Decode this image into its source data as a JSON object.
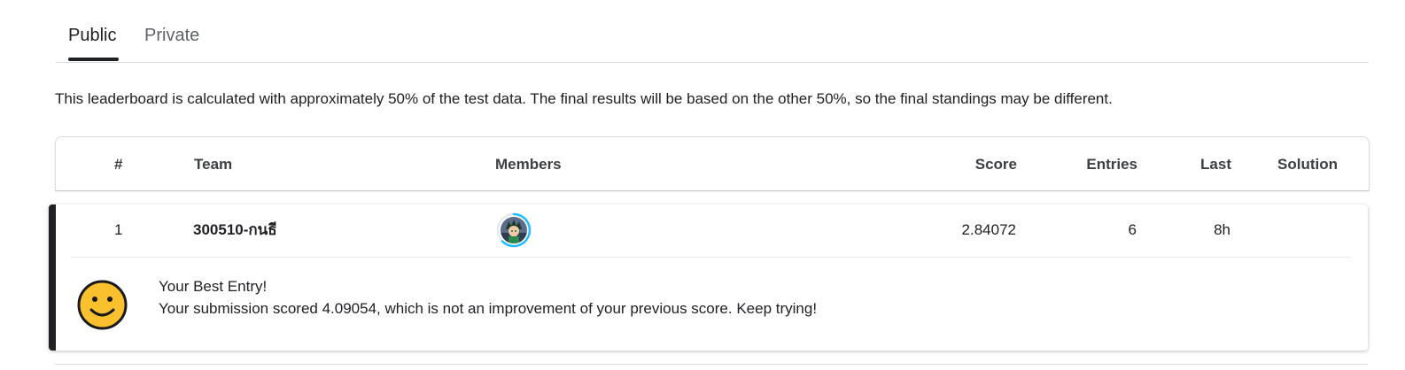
{
  "tabs": [
    {
      "label": "Public",
      "active": true
    },
    {
      "label": "Private",
      "active": false
    }
  ],
  "notice": "This leaderboard is calculated with approximately 50% of the test data. The final results will be based on the other 50%, so the final standings may be different.",
  "table": {
    "columns": [
      "#",
      "Team",
      "Members",
      "Score",
      "Entries",
      "Last",
      "Solution"
    ],
    "rows": [
      {
        "rank": "1",
        "team": "300510-กนธี",
        "members_icon": "user-avatar",
        "score": "2.84072",
        "entries": "6",
        "last": "8h",
        "solution": ""
      }
    ]
  },
  "best_entry": {
    "icon": "smiley-face-icon",
    "title": "Your Best Entry!",
    "message": "Your submission scored 4.09054, which is not an improvement of your previous score. Keep trying!"
  },
  "colors": {
    "accent": "#202124",
    "ring": "#20beff",
    "smiley": "#fbc02d"
  }
}
